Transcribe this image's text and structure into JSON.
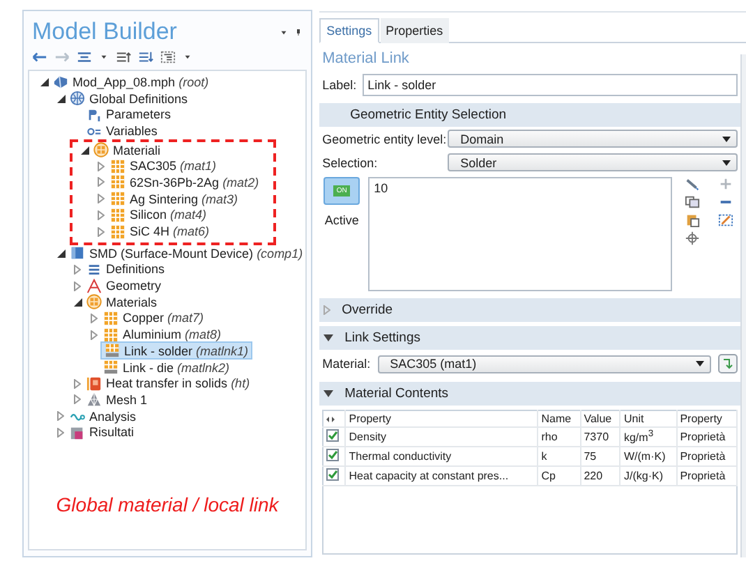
{
  "model_builder": {
    "title": "Model Builder"
  },
  "tree": [
    {
      "label": "Mod_App_08.mph",
      "tag": "(root)",
      "kind": "file",
      "expanded": true,
      "selected": false,
      "children": [
        {
          "label": "Global Definitions",
          "kind": "globe",
          "expanded": true,
          "selected": false,
          "children": [
            {
              "label": "Parameters",
              "kind": "parameters",
              "selected": false
            },
            {
              "label": "Variables",
              "kind": "variables",
              "selected": false
            },
            {
              "label": "Materiali",
              "kind": "materials",
              "expanded": true,
              "selected": false,
              "highlighted": true,
              "children": [
                {
                  "label": "SAC305",
                  "tag": "(mat1)",
                  "kind": "material",
                  "expanded": false,
                  "selected": false
                },
                {
                  "label": "62Sn-36Pb-2Ag",
                  "tag": "(mat2)",
                  "kind": "material",
                  "expanded": false,
                  "selected": false
                },
                {
                  "label": "Ag Sintering",
                  "tag": "(mat3)",
                  "kind": "material",
                  "expanded": false,
                  "selected": false
                },
                {
                  "label": "Silicon",
                  "tag": "(mat4)",
                  "kind": "material",
                  "expanded": false,
                  "selected": false
                },
                {
                  "label": "SiC 4H",
                  "tag": "(mat6)",
                  "kind": "material",
                  "expanded": false,
                  "selected": false
                }
              ]
            }
          ]
        },
        {
          "label": "SMD (Surface-Mount Device)",
          "tag": "(comp1)",
          "kind": "component",
          "expanded": true,
          "selected": false,
          "children": [
            {
              "label": "Definitions",
              "kind": "definitions",
              "expanded": false,
              "selected": false
            },
            {
              "label": "Geometry",
              "kind": "geometry",
              "expanded": false,
              "selected": false
            },
            {
              "label": "Materials",
              "kind": "materials",
              "expanded": true,
              "selected": false,
              "children": [
                {
                  "label": "Copper",
                  "tag": "(mat7)",
                  "kind": "material",
                  "expanded": false,
                  "selected": false
                },
                {
                  "label": "Aluminium",
                  "tag": "(mat8)",
                  "kind": "material",
                  "expanded": false,
                  "selected": false
                },
                {
                  "label": "Link - solder",
                  "tag": "(matlnk1)",
                  "kind": "link",
                  "selected": true
                },
                {
                  "label": "Link - die",
                  "tag": "(matlnk2)",
                  "kind": "link",
                  "selected": false
                }
              ]
            },
            {
              "label": "Heat transfer in solids",
              "tag": "(ht)",
              "kind": "physics",
              "expanded": false,
              "selected": false
            },
            {
              "label": "Mesh 1",
              "kind": "mesh",
              "expanded": false,
              "selected": false
            }
          ]
        },
        {
          "label": "Analysis",
          "kind": "analysis",
          "expanded": false,
          "selected": false
        },
        {
          "label": "Risultati",
          "kind": "results",
          "expanded": false,
          "selected": false
        }
      ]
    }
  ],
  "annotation": "Global material / local link",
  "tabs": [
    {
      "label": "Settings",
      "selected": true
    },
    {
      "label": "Properties",
      "selected": false
    }
  ],
  "heading": "Material Link",
  "label_field": {
    "label": "Label:",
    "value": "Link - solder"
  },
  "geometric_entity_selection": {
    "title": "Geometric Entity Selection",
    "entity_level": {
      "label": "Geometric entity level:",
      "value": "Domain"
    },
    "selection": {
      "label": "Selection:",
      "value": "Solder"
    },
    "active": {
      "label": "Active",
      "toggle_text": "ON",
      "on": true
    },
    "selection_list": [
      "10"
    ]
  },
  "override": {
    "title": "Override",
    "expanded": false
  },
  "link_settings": {
    "title": "Link Settings",
    "expanded": true,
    "material": {
      "label": "Material:",
      "value": "SAC305 (mat1)"
    }
  },
  "material_contents": {
    "title": "Material Contents",
    "expanded": true,
    "columns": [
      "Property",
      "Name",
      "Value",
      "Unit",
      "Property"
    ],
    "rows": [
      {
        "checked": true,
        "cells": [
          "Density",
          "rho",
          "7370",
          "kg/m$^{3}$",
          "Proprietà"
        ]
      },
      {
        "checked": true,
        "cells": [
          "Thermal conductivity",
          "k",
          "75",
          "W/(m·K)",
          "Proprietà"
        ]
      },
      {
        "checked": true,
        "cells": [
          "Heat capacity at constant pres...",
          "Cp",
          "220",
          "J/(kg·K)",
          "Proprietà"
        ]
      }
    ]
  }
}
